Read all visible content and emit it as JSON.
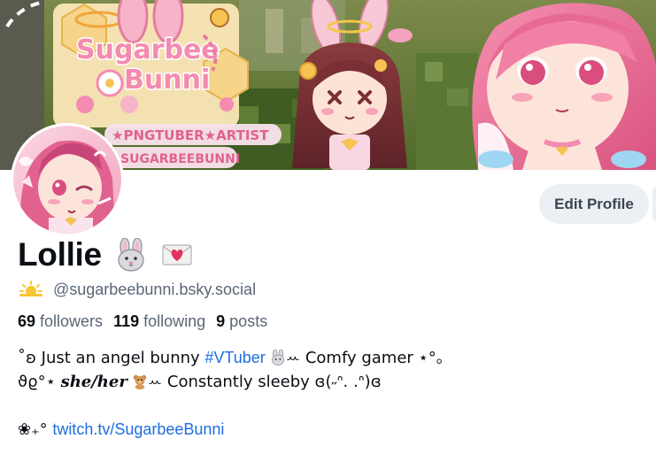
{
  "banner": {
    "logo_line1": "Sugarbee",
    "logo_line2": "Bunni",
    "tagline": "★PNGTUBER★ARTIST",
    "banner_handle": "@SUGARBEEBUNNI"
  },
  "profile": {
    "display_name": "Lollie",
    "handle": "@sugarbeebunni.bsky.social",
    "edit_label": "Edit Profile"
  },
  "stats": {
    "followers_count": "69",
    "followers_label": "followers",
    "following_count": "119",
    "following_label": "following",
    "posts_count": "9",
    "posts_label": "posts"
  },
  "bio": {
    "line1_prefix": "˚ʚ Just an angel bunny ",
    "line1_tag": "#VTuber",
    "line1_suffix": "ꕀ Comfy gamer ⋆°｡",
    "line2_prefix": "ϑϱ°⋆ ",
    "line2_pronoun": "she/her",
    "line2_suffix": "ꕀ Constantly sleeby ɞ(˶ᐢ. .ᐢ)ɞ",
    "line4_prefix": "❀₊° ",
    "line4_link": "twitch.tv/SugarbeeBunni"
  },
  "icons": {
    "name_emoji_1": "rabbit-face-icon",
    "name_emoji_2": "love-letter-icon",
    "handle_emoji": "sun-behind-cloud-icon"
  },
  "colors": {
    "accent_link": "#1d6ee0",
    "muted_text": "#5a6676",
    "primary_text": "#0b0f14",
    "button_bg": "#eceff3"
  }
}
